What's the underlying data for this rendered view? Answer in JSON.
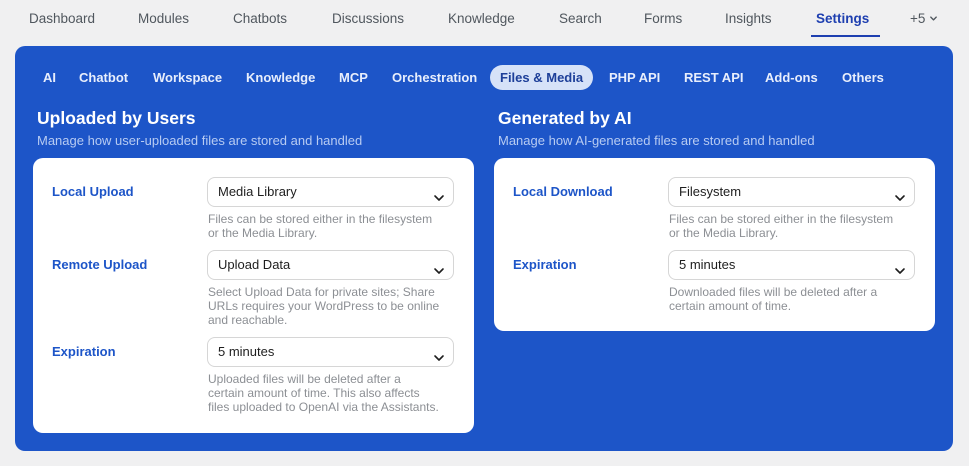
{
  "topnav": {
    "items": [
      "Dashboard",
      "Modules",
      "Chatbots",
      "Discussions",
      "Knowledge",
      "Search",
      "Forms",
      "Insights",
      "Settings"
    ],
    "more_label": "+5",
    "active": "Settings"
  },
  "subtabs": {
    "items": [
      "AI",
      "Chatbot",
      "Workspace",
      "Knowledge",
      "MCP",
      "Orchestration",
      "Files & Media",
      "PHP API",
      "REST API",
      "Add-ons",
      "Others"
    ],
    "active": "Files & Media"
  },
  "uploaded": {
    "title": "Uploaded by Users",
    "subtitle": "Manage how user-uploaded files are stored and handled",
    "fields": [
      {
        "label": "Local Upload",
        "value": "Media Library",
        "help": [
          "Files can be stored either in the filesystem",
          "or the Media Library."
        ]
      },
      {
        "label": "Remote Upload",
        "value": "Upload Data",
        "help": [
          "Select Upload Data for private sites; Share",
          "URLs requires your WordPress to be online",
          "and reachable."
        ]
      },
      {
        "label": "Expiration",
        "value": "5 minutes",
        "help": [
          "Uploaded files will be deleted after a",
          "certain amount of time. This also affects",
          "files uploaded to OpenAI via the Assistants."
        ]
      }
    ]
  },
  "generated": {
    "title": "Generated by AI",
    "subtitle": "Manage how AI-generated files are stored and handled",
    "fields": [
      {
        "label": "Local Download",
        "value": "Filesystem",
        "help": [
          "Files can be stored either in the filesystem",
          "or the Media Library."
        ]
      },
      {
        "label": "Expiration",
        "value": "5 minutes",
        "help": [
          "Downloaded files will be deleted after a",
          "certain amount of time."
        ]
      }
    ]
  },
  "colors": {
    "panel": "#1d55c8",
    "accent": "#1e3fb0",
    "active_tab_bg": "#d6e2f8"
  }
}
